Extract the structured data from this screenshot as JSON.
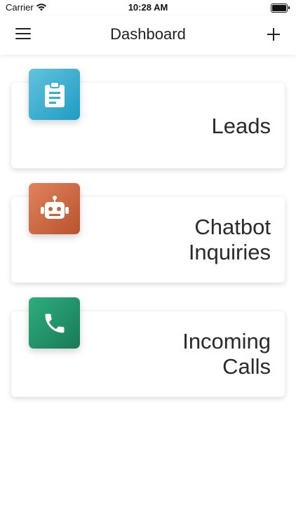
{
  "status": {
    "carrier": "Carrier",
    "time": "10:28 AM"
  },
  "nav": {
    "title": "Dashboard",
    "menu_icon": "hamburger-menu-icon",
    "add_icon": "plus-icon"
  },
  "cards": [
    {
      "id": "leads",
      "icon": "clipboard-icon",
      "color": "#1e9cc4",
      "lines": [
        "Leads"
      ]
    },
    {
      "id": "chatbot",
      "icon": "robot-icon",
      "color": "#b8532f",
      "lines": [
        "Chatbot",
        "Inquiries"
      ]
    },
    {
      "id": "calls",
      "icon": "phone-icon",
      "color": "#1a7a56",
      "lines": [
        "Incoming",
        "Calls"
      ]
    }
  ]
}
